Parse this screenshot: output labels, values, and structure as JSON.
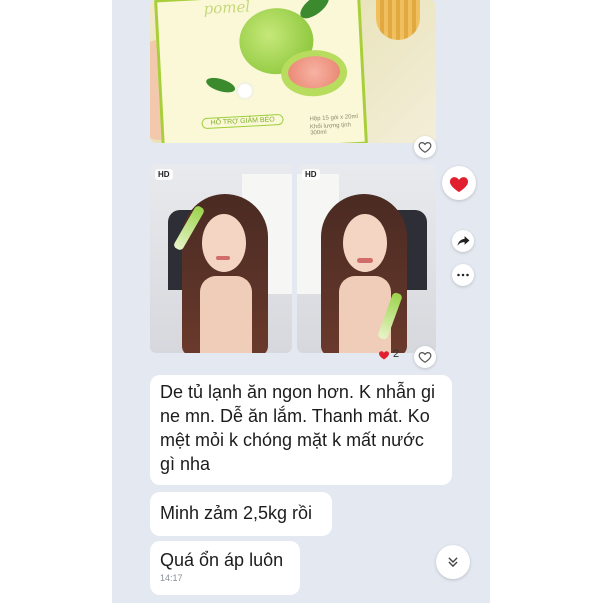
{
  "photos": {
    "top": {
      "brand": "pomel",
      "pill": "HỖ TRỢ GIẢM BÉO",
      "fine_line1": "Hộp 15 gói x 20ml",
      "fine_line2": "Khối lượng tịnh 300ml"
    },
    "left_badge": "HD",
    "right_badge": "HD",
    "reaction_count": "2"
  },
  "messages": [
    {
      "text": "De tủ lạnh ăn ngon hơn. K nhẫn gi ne mn. Dễ ăn lắm. Thanh mát. Ko mệt mỏi k chóng mặt k mất nước gì nha"
    },
    {
      "text": "Minh zảm 2,5kg rồi"
    },
    {
      "text": "Quá ổn áp luôn",
      "time": "14:17"
    }
  ],
  "icons": {
    "like": "heart-outline-icon",
    "react": "heart-filled-icon",
    "share": "share-arrow-icon",
    "more": "more-dots-icon",
    "scroll": "chevron-double-down-icon"
  },
  "colors": {
    "chat_bg": "#e4e8f0",
    "heart": "#e0202e",
    "bubble": "#ffffff"
  }
}
